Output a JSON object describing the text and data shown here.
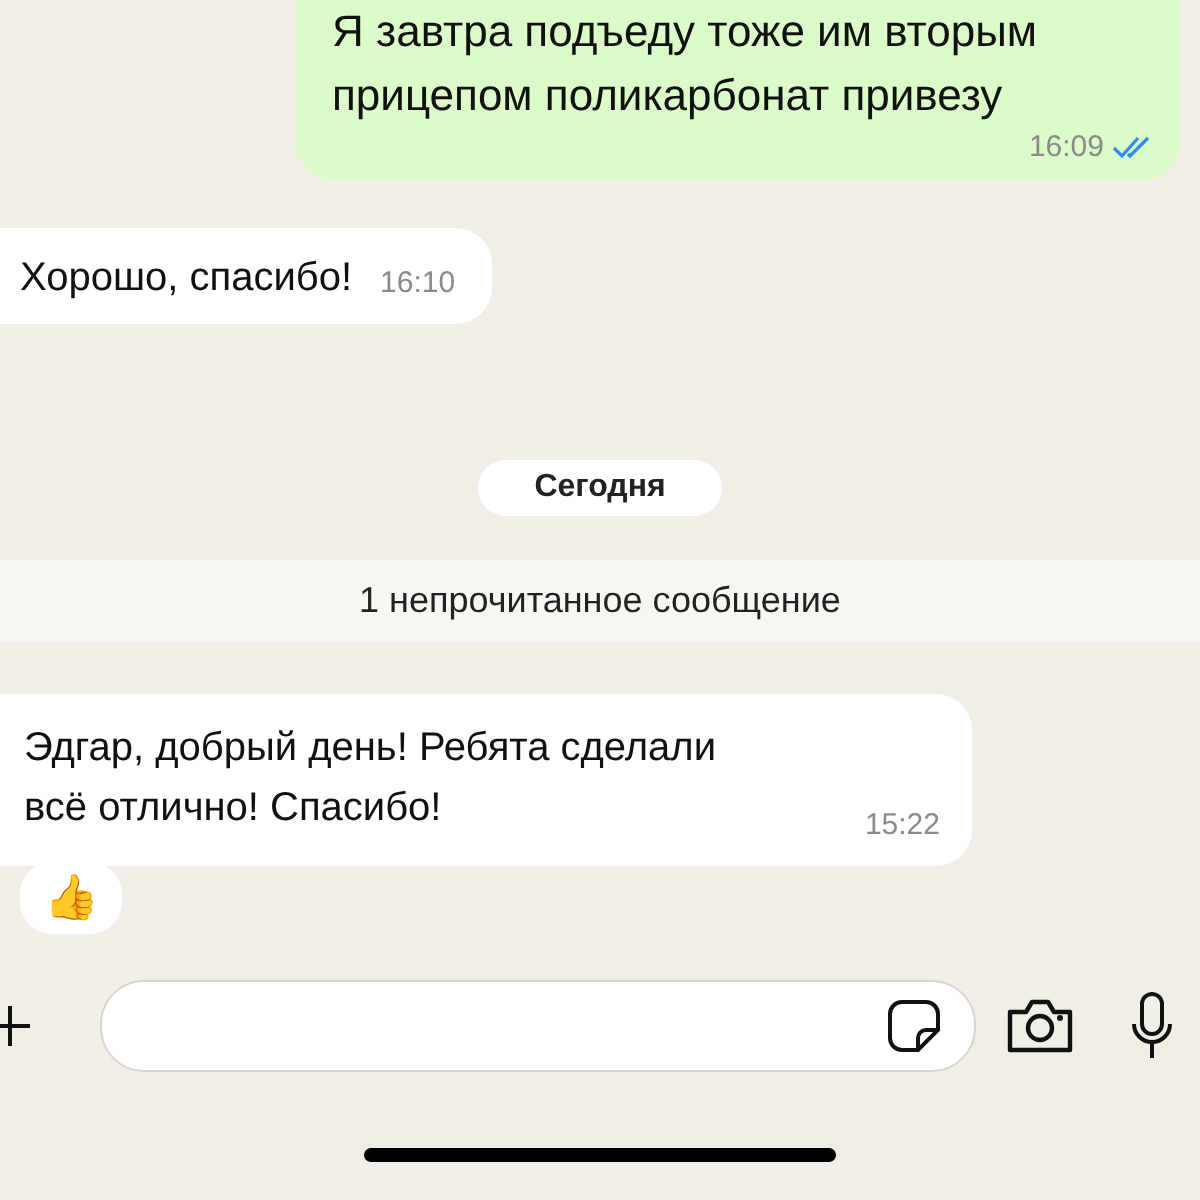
{
  "messages": [
    {
      "kind": "outgoing",
      "text": "Я завтра подъеду тоже им вторым прицепом поликарбонат привезу",
      "time": "16:09",
      "read": true
    },
    {
      "kind": "incoming",
      "text": "Хорошо, спасибо!",
      "time": "16:10"
    },
    {
      "kind": "date",
      "text": "Сегодня"
    },
    {
      "kind": "unread",
      "text": "1 непрочитанное сообщение"
    },
    {
      "kind": "incoming",
      "text": "Эдгар, добрый день! Ребята сделали всё отлично! Спасибо!",
      "time": "15:22",
      "reaction": "👍"
    }
  ]
}
